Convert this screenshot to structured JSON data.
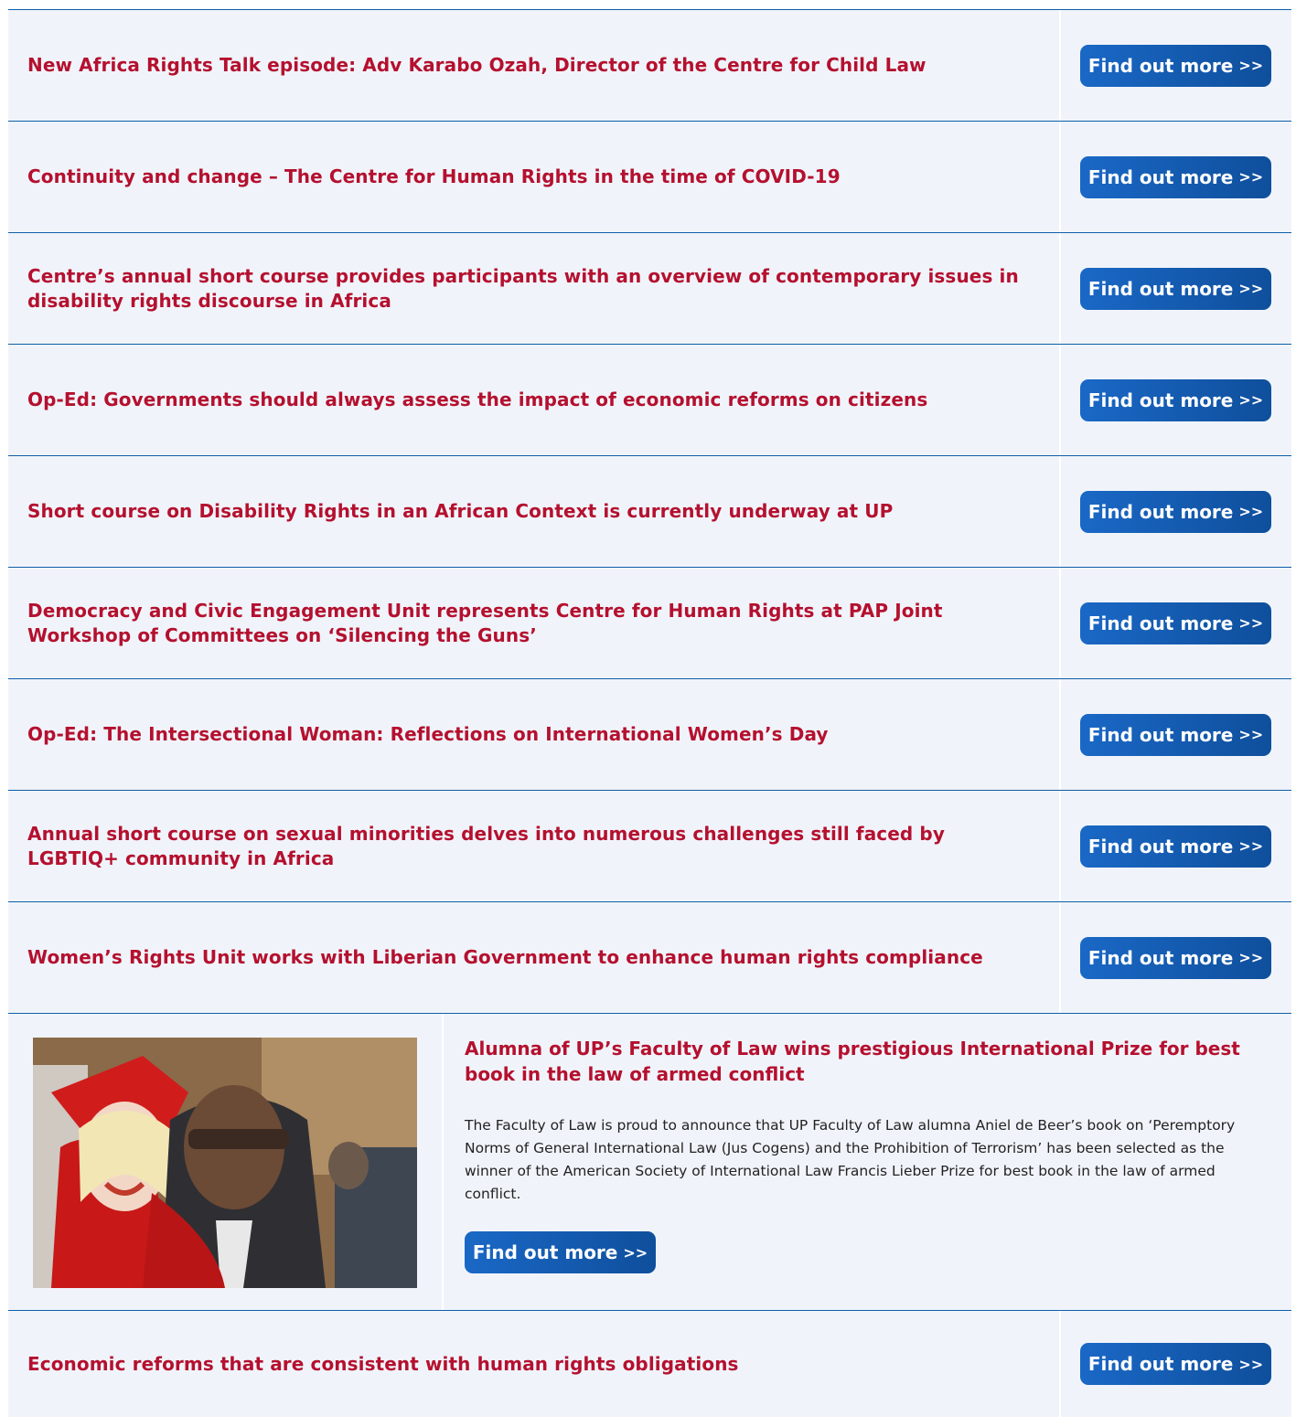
{
  "news": [
    {
      "title": "New Africa Rights Talk episode: Adv Karabo Ozah, Director of the Centre for Child Law",
      "cta": "Find out more",
      "arrows": ">>"
    },
    {
      "title": "Continuity and change – The Centre for Human Rights in the time of COVID-19",
      "cta": "Find out more",
      "arrows": ">>"
    },
    {
      "title": "Centre’s annual short course provides participants with an overview of contemporary issues in disability rights discourse in Africa",
      "cta": "Find out more",
      "arrows": ">>"
    },
    {
      "title": "Op-Ed: Governments should always assess the impact of economic reforms on citizens",
      "cta": "Find out more",
      "arrows": ">>"
    },
    {
      "title": "Short course on Disability Rights in an African Context is currently underway at UP",
      "cta": "Find out more",
      "arrows": ">>"
    },
    {
      "title": "Democracy and Civic Engagement Unit represents Centre for Human Rights at PAP Joint Workshop of Committees on ‘Silencing the Guns’",
      "cta": "Find out more",
      "arrows": ">>"
    },
    {
      "title": "Op-Ed: The Intersectional Woman: Reflections on International Women’s Day",
      "cta": "Find out more",
      "arrows": ">>"
    },
    {
      "title": "Annual short course on sexual minorities delves into numerous challenges still faced by LGBTIQ+ community in Africa",
      "cta": "Find out more",
      "arrows": ">>"
    },
    {
      "title": "Women’s Rights Unit works with Liberian Government to enhance human rights compliance",
      "cta": "Find out more",
      "arrows": ">>"
    }
  ],
  "feature": {
    "title": "Alumna of UP’s Faculty of Law wins prestigious International Prize for best book in the law of armed conflict",
    "description": "The Faculty of Law is proud to announce that UP Faculty of Law alumna Aniel de Beer’s book on ‘Peremptory Norms of General International Law (Jus Cogens) and the Prohibition of Terrorism’ has been selected as the winner of the American Society of International Law Francis Lieber Prize for best book in the law of armed conflict.",
    "cta": "Find out more",
    "arrows": ">>"
  },
  "last": {
    "title": "Economic reforms that are consistent with human rights obligations",
    "cta": "Find out more",
    "arrows": ">>"
  },
  "colors": {
    "title_red": "#b5102f",
    "button_blue": "#1a68c6",
    "row_bg": "#f0f4fa",
    "divider": "#0f5ea8"
  }
}
